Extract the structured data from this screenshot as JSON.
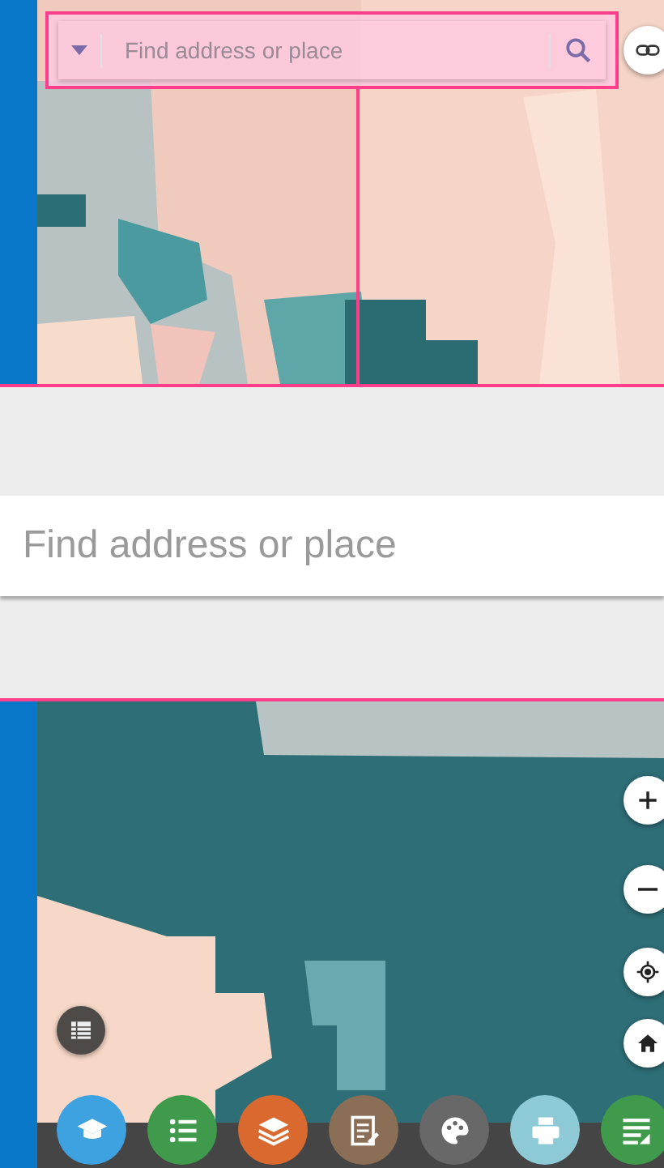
{
  "search_bar": {
    "placeholder": "Find address or place"
  },
  "zoomed_search": {
    "placeholder": "Find address or place"
  },
  "map_controls": [
    {
      "kind": "zoom-in"
    },
    {
      "kind": "zoom-out"
    },
    {
      "kind": "locate"
    },
    {
      "kind": "home"
    }
  ],
  "toolbar": [
    {
      "kind": "learn",
      "color": "#3fa2e0"
    },
    {
      "kind": "legend",
      "color": "#3f9a4b"
    },
    {
      "kind": "layers",
      "color": "#d9692e"
    },
    {
      "kind": "notes",
      "color": "#8a6e55"
    },
    {
      "kind": "style",
      "color": "#686868"
    },
    {
      "kind": "print",
      "color": "#8ecad6"
    },
    {
      "kind": "edit",
      "color": "#3f9a4b"
    }
  ]
}
